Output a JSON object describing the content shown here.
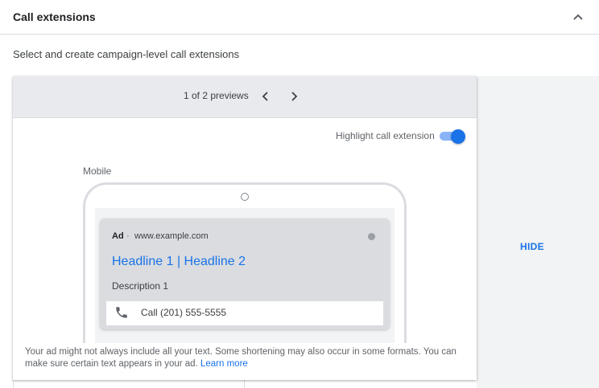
{
  "section": {
    "title": "Call extensions",
    "subtitle": "Select and create campaign-level call extensions",
    "collapse_icon": "chevron-up-icon"
  },
  "preview": {
    "count_text": "1 of 2 previews",
    "prev_icon": "chevron-left-icon",
    "next_icon": "chevron-right-icon",
    "toggle_label": "Highlight call extension",
    "toggle_on": true,
    "device_label": "Mobile",
    "ad": {
      "badge": "Ad",
      "separator": "·",
      "url": "www.example.com",
      "headline": "Headline 1 | Headline 2",
      "description": "Description 1",
      "call_icon": "phone-icon",
      "call_text": "Call (201) 555-5555"
    },
    "disclaimer_text": "Your ad might not always include all your text. Some shortening may also occur in some formats. You can make sure certain text appears in your ad.",
    "learn_more": "Learn more"
  },
  "side_panel": {
    "hide_label": "HIDE"
  },
  "colors": {
    "accent": "#1a73e8",
    "toggle_track": "#8ab4f8",
    "panel_bg": "#f1f3f4",
    "toolbar_bg": "#e8eaed",
    "ad_card_bg": "#dadce0"
  }
}
